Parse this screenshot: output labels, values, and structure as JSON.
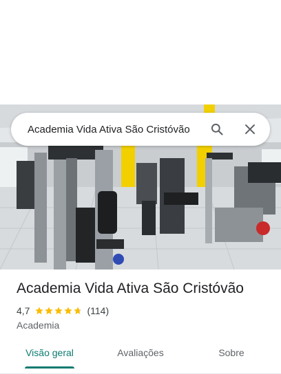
{
  "search": {
    "query": "Academia Vida Ativa São Cristóvão"
  },
  "icons": {
    "search": "search-icon",
    "close": "close-icon",
    "star": "star-icon"
  },
  "place": {
    "name": "Academia Vida Ativa São Cristóvão",
    "rating": "4,7",
    "rating_value": 4.7,
    "review_count": "(114)",
    "category": "Academia"
  },
  "tabs": [
    {
      "label": "Visão geral",
      "active": true
    },
    {
      "label": "Avaliações",
      "active": false
    },
    {
      "label": "Sobre",
      "active": false
    }
  ],
  "colors": {
    "accent": "#0b7a70",
    "star": "#fbbc04",
    "wall_yellow": "#f2d000"
  }
}
